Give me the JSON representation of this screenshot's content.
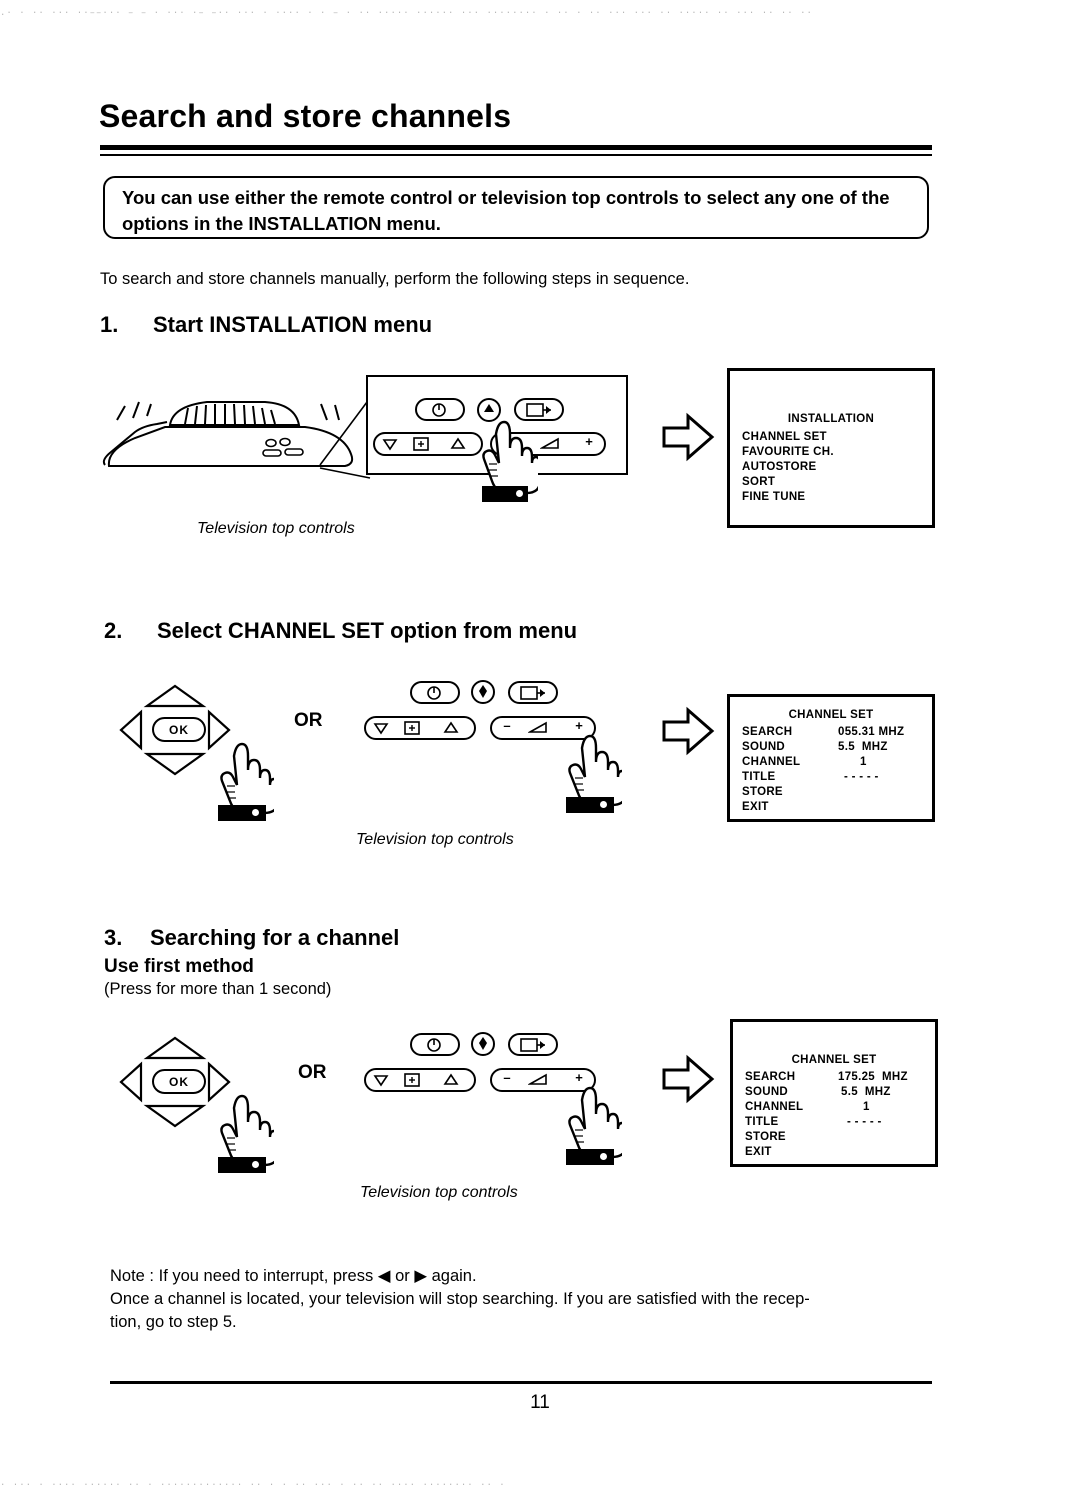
{
  "document": {
    "title": "Search and store channels",
    "callout": "You can use either the remote control or television top controls to select any one of the options in the INSTALLATION menu.",
    "intro": "To search and store channels manually, perform the following steps in sequence.",
    "page_number": "11"
  },
  "steps": [
    {
      "number": "1.",
      "title": "Start  INSTALLATION menu",
      "caption": "Television top controls",
      "screen": {
        "title": "INSTALLATION",
        "rows": [
          {
            "label": "CHANNEL SET",
            "value": ""
          },
          {
            "label": "FAVOURITE CH.",
            "value": ""
          },
          {
            "label": "AUTOSTORE",
            "value": ""
          },
          {
            "label": "SORT",
            "value": ""
          },
          {
            "label": "FINE TUNE",
            "value": ""
          }
        ]
      }
    },
    {
      "number": "2.",
      "title": "Select CHANNEL SET option from menu",
      "caption": "Television top controls",
      "or_label": "OR",
      "screen": {
        "title": "CHANNEL SET",
        "rows": [
          {
            "label": "SEARCH",
            "value": "055.31 MHZ"
          },
          {
            "label": "SOUND",
            "value": "5.5  MHZ"
          },
          {
            "label": "CHANNEL",
            "value": "1"
          },
          {
            "label": "TITLE",
            "value": "- - - - -"
          },
          {
            "label": "STORE",
            "value": ""
          },
          {
            "label": "EXIT",
            "value": ""
          }
        ]
      }
    },
    {
      "number": "3.",
      "title": "Searching for  a channel",
      "sub_head": "Use first method",
      "sub_note": "(Press for more than 1 second)",
      "caption": "Television top controls",
      "or_label": "OR",
      "screen": {
        "title": "CHANNEL SET",
        "rows": [
          {
            "label": "SEARCH",
            "value": "175.25  MHZ"
          },
          {
            "label": "SOUND",
            "value": "5.5  MHZ"
          },
          {
            "label": "CHANNEL",
            "value": "1"
          },
          {
            "label": "TITLE",
            "value": "- - - - -"
          },
          {
            "label": "STORE",
            "value": ""
          },
          {
            "label": "EXIT",
            "value": ""
          }
        ]
      }
    }
  ],
  "note": {
    "line1": "Note : If you need to interrupt, press  ◀  or  ▶   again.",
    "line2": "Once a channel is located, your television will stop searching. If you are satisfied with the recep-",
    "line3": "tion, go to  step 5."
  },
  "controls": {
    "ok_label": "OK",
    "power_icon": "power-icon",
    "up_icon": "up-arrow-icon",
    "source_icon": "source-icon",
    "menu_icon": "menu-icon",
    "down_icon": "down-triangle-icon",
    "box_icon": "box-icon",
    "up_tri_icon": "up-triangle-icon",
    "minus_label": "–",
    "plus_label": "+",
    "volume_icon": "volume-icon"
  },
  "scan_noise": {
    "top": "  .·   ·     ·· ···  ··––··· – –      · ··· ·– –··  ··· · ···· ·   · – · ·· ·····   ······ ···  ········ ·  ·· · ·· ··· ··· ·· ·····   ·· ··· ·· ·· ··",
    "bottom": "   · ··· · ···· ······ ··        · ············· ·· · ·  ·· ···            · ··   ·· ····  ········ ·· ·"
  }
}
